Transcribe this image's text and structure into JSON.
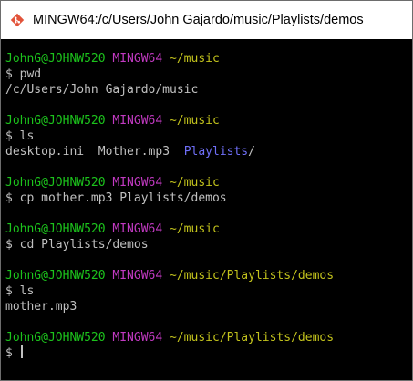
{
  "window": {
    "title": "MINGW64:/c/Users/John Gajardo/music/Playlists/demos",
    "icon": "git-bash-icon"
  },
  "colors": {
    "user": "#1cc31c",
    "host": "#c23ac2",
    "path": "#c2c21c",
    "directory": "#6f6ff7",
    "text": "#c0c0c0",
    "background": "#000000"
  },
  "terminal": {
    "prompts": [
      {
        "user": "JohnG@JOHNW520",
        "host": "MINGW64",
        "path": "~/music"
      },
      {
        "user": "JohnG@JOHNW520",
        "host": "MINGW64",
        "path": "~/music"
      },
      {
        "user": "JohnG@JOHNW520",
        "host": "MINGW64",
        "path": "~/music"
      },
      {
        "user": "JohnG@JOHNW520",
        "host": "MINGW64",
        "path": "~/music"
      },
      {
        "user": "JohnG@JOHNW520",
        "host": "MINGW64",
        "path": "~/music/Playlists/demos"
      },
      {
        "user": "JohnG@JOHNW520",
        "host": "MINGW64",
        "path": "~/music/Playlists/demos"
      }
    ],
    "commands": [
      "$ pwd",
      "$ ls",
      "$ cp mother.mp3 Playlists/demos",
      "$ cd Playlists/demos",
      "$ ls",
      "$ "
    ],
    "outputs": {
      "pwd": "/c/Users/John Gajardo/music",
      "ls1_file1": "desktop.ini",
      "ls1_file2": "Mother.mp3",
      "ls1_dir": "Playlists",
      "ls1_dir_suffix": "/",
      "ls2": "mother.mp3"
    }
  }
}
